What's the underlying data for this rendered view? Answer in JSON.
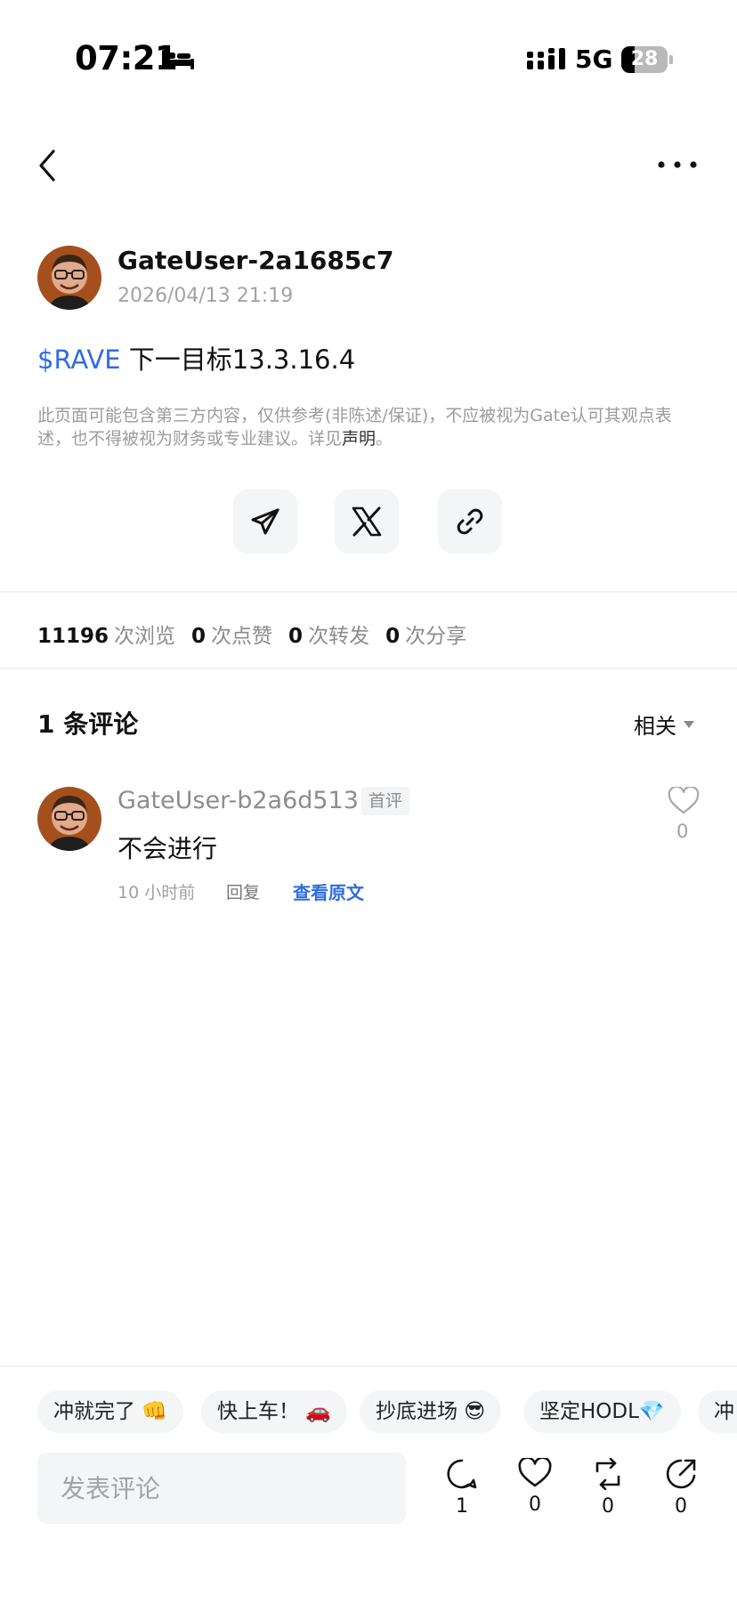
{
  "status_bar": {
    "time": "07:21",
    "network": "5G",
    "battery": "28",
    "battery_level": 0.28
  },
  "post": {
    "author": "GateUser-2a1685c7",
    "timestamp": "2026/04/13 21:19",
    "tag": "$RAVE",
    "text": " 下一目标13.3.16.4",
    "disclaimer_text": "此页面可能包含第三方内容，仅供参考(非陈述/保证)，不应被视为Gate认可其观点表述，也不得被视为财务或专业建议。详见",
    "disclaimer_link": "声明",
    "disclaimer_end": "。"
  },
  "share": {
    "telegram_icon": "telegram-icon",
    "x_icon": "x-icon",
    "link_icon": "link-icon"
  },
  "stats": {
    "views": "11196",
    "views_label": "次浏览",
    "likes": "0",
    "likes_label": "次点赞",
    "reposts": "0",
    "reposts_label": "次转发",
    "shares": "0",
    "shares_label": "次分享"
  },
  "comments": {
    "count_label": "1 条评论",
    "sort_label": "相关",
    "items": [
      {
        "author": "GateUser-b2a6d513",
        "badge": "首评",
        "text": "不会进行",
        "time": "10 小时前",
        "reply_label": "回复",
        "view_original_label": "查看原文",
        "likes": "0"
      }
    ]
  },
  "quick_replies": [
    "冲就完了 👊",
    "快上车！ 🚗",
    "抄底进场 😎",
    "坚定HODL💎",
    "冲"
  ],
  "composer": {
    "placeholder": "发表评论"
  },
  "actions": {
    "comments": "1",
    "likes": "0",
    "reposts": "0",
    "shares": "0"
  },
  "colors": {
    "accent": "#2f6de1",
    "muted": "#a3a3a3",
    "chip_bg": "#f4f5f6"
  }
}
